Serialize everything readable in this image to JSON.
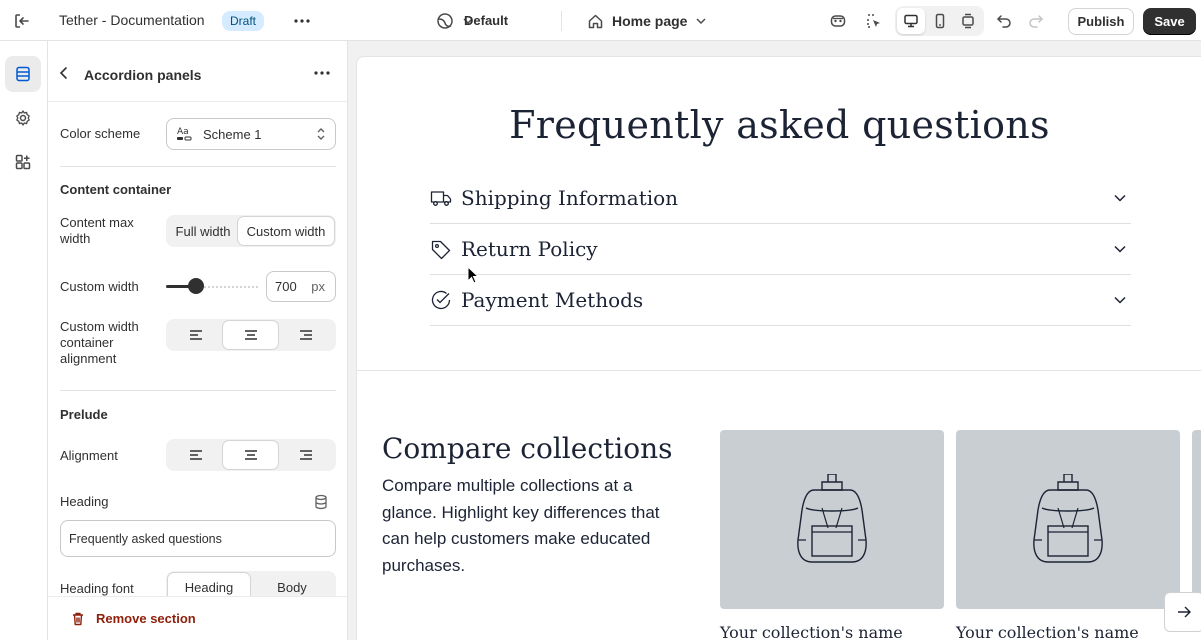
{
  "topbar": {
    "store_name": "Tether - Documentation",
    "status_badge": "Draft",
    "theme_label": "Default",
    "page_label": "Home page",
    "publish_label": "Publish",
    "save_label": "Save",
    "icons": [
      "exit-icon",
      "more-icon",
      "theme-icon",
      "home-icon",
      "ai-icon",
      "inspector-icon",
      "desktop-icon",
      "mobile-icon",
      "fullscreen-icon",
      "undo-icon",
      "redo-icon"
    ]
  },
  "rail": {
    "items": [
      "sections-icon",
      "settings-icon",
      "apps-icon"
    ]
  },
  "panel": {
    "title": "Accordion panels",
    "color_scheme_label": "Color scheme",
    "color_scheme_value": "Scheme 1",
    "content_container_title": "Content container",
    "content_max_width_label": "Content max width",
    "width_options": [
      "Full width",
      "Custom width"
    ],
    "custom_width_label": "Custom width",
    "custom_width_value": "700",
    "custom_width_unit": "px",
    "slider_fraction": 0.33,
    "alignment_container_label": "Custom width container alignment",
    "prelude_title": "Prelude",
    "alignment_label": "Alignment",
    "heading_label": "Heading",
    "heading_value": "Frequently asked questions",
    "heading_font_label": "Heading font",
    "heading_font_options": [
      "Heading",
      "Body"
    ],
    "remove_section_label": "Remove section",
    "danger_color": "#8e1f0b"
  },
  "preview": {
    "faq_title": "Frequently asked questions",
    "accordion": [
      {
        "label": "Shipping Information",
        "icon": "truck-icon"
      },
      {
        "label": "Return Policy",
        "icon": "tag-icon"
      },
      {
        "label": "Payment Methods",
        "icon": "check-circle-icon"
      }
    ],
    "compare_title": "Compare collections",
    "compare_body": "Compare multiple collections at a glance. Highlight key differences that can help customers make educated purchases.",
    "collections": [
      {
        "name": "Your collection's name"
      },
      {
        "name": "Your collection's name"
      }
    ]
  }
}
